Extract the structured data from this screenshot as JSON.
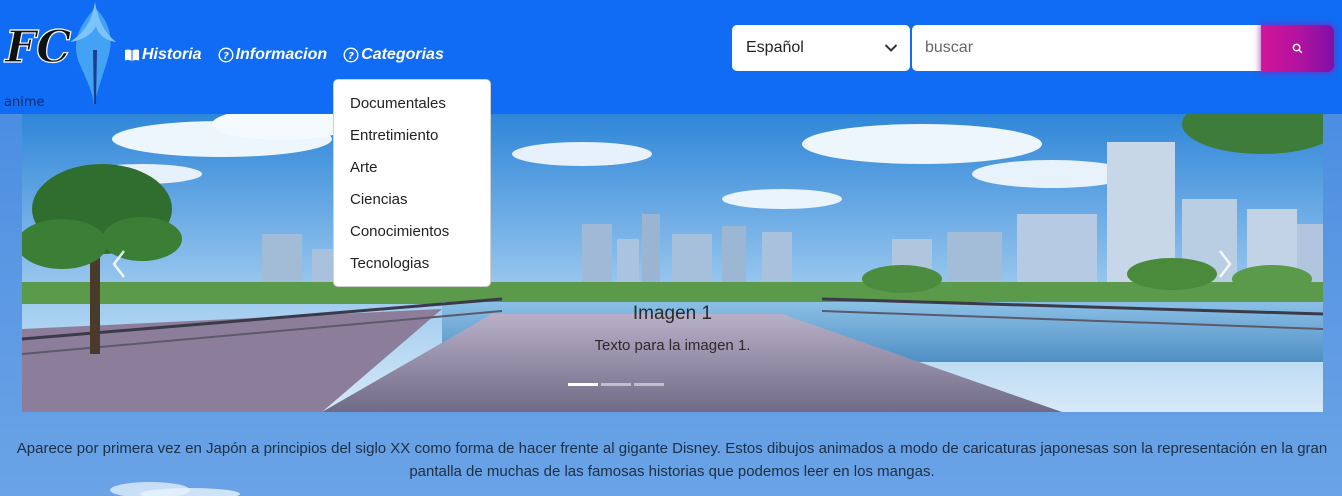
{
  "brand": {
    "logo_text": "FC",
    "logo_subtext": "anime"
  },
  "nav": {
    "items": [
      {
        "label": "Historia",
        "icon": "book-icon"
      },
      {
        "label": "Informacion",
        "icon": "question-circle-icon"
      },
      {
        "label": "Categorias",
        "icon": "question-circle-icon"
      }
    ]
  },
  "language_select": {
    "selected": "Español"
  },
  "search": {
    "placeholder": "buscar",
    "button_icon": "search-icon"
  },
  "dropdown": {
    "items": [
      "Documentales",
      "Entretimiento",
      "Arte",
      "Ciencias",
      "Conocimientos",
      "Tecnologias"
    ]
  },
  "carousel": {
    "slide_title": "Imagen 1",
    "slide_text": "Texto para la imagen 1.",
    "indicator_count": 3,
    "active_indicator": 0
  },
  "description": "Aparece por primera vez en Japón a principios del siglo XX como forma de hacer frente al gigante Disney. Estos dibujos animados a modo de caricaturas japonesas son la representación en la gran pantalla de muchas de las famosas historias que podemos leer en los mangas.",
  "colors": {
    "navbar": "#106cf4",
    "search_button": "#c014a0",
    "page_background": "#4a8de2"
  }
}
